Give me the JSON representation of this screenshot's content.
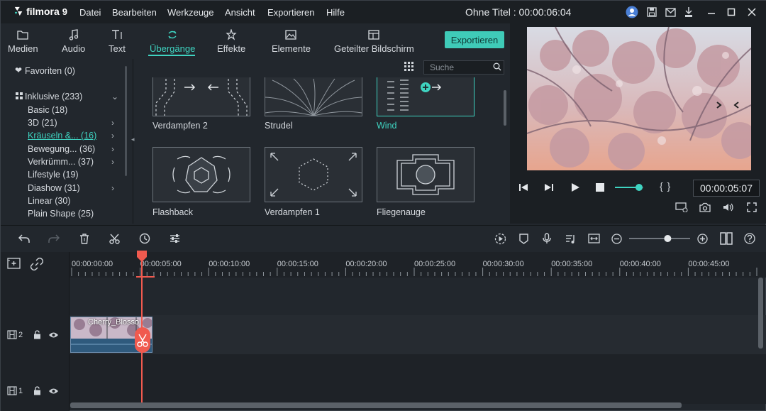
{
  "app": {
    "brand": "filmora",
    "version": "9"
  },
  "menu": {
    "items": [
      "Datei",
      "Bearbeiten",
      "Werkzeuge",
      "Ansicht",
      "Exportieren",
      "Hilfe"
    ]
  },
  "window": {
    "title": "Ohne Titel : 00:00:06:04"
  },
  "tabs": [
    {
      "label": "Medien",
      "icon": "folder-icon"
    },
    {
      "label": "Audio",
      "icon": "music-note-icon"
    },
    {
      "label": "Text",
      "icon": "text-icon"
    },
    {
      "label": "Übergänge",
      "icon": "transition-icon",
      "active": true
    },
    {
      "label": "Effekte",
      "icon": "effects-icon"
    },
    {
      "label": "Elemente",
      "icon": "image-icon"
    },
    {
      "label": "Geteilter Bildschirm",
      "icon": "split-screen-icon"
    }
  ],
  "export_label": "Exportieren",
  "search": {
    "placeholder": "Suche"
  },
  "sidebar": {
    "favorites": "Favoriten (0)",
    "inclusive": "Inklusive (233)",
    "items": [
      {
        "label": "Basic (18)",
        "arrow": false
      },
      {
        "label": "3D (21)",
        "arrow": true
      },
      {
        "label": "Kräuseln &... (16)",
        "arrow": true,
        "active": true
      },
      {
        "label": "Bewegung... (36)",
        "arrow": true
      },
      {
        "label": "Verkrümm... (37)",
        "arrow": true
      },
      {
        "label": "Lifestyle (19)",
        "arrow": false
      },
      {
        "label": "Diashow (31)",
        "arrow": true
      },
      {
        "label": "Linear (30)",
        "arrow": false
      },
      {
        "label": "Plain Shape (25)",
        "arrow": false
      }
    ]
  },
  "transitions": [
    {
      "label": "Verdampfen 2"
    },
    {
      "label": "Strudel"
    },
    {
      "label": "Wind",
      "selected": true
    },
    {
      "label": "Flashback"
    },
    {
      "label": "Verdampfen 1"
    },
    {
      "label": "Fliegenauge"
    }
  ],
  "preview": {
    "timecode": "00:00:05:07",
    "progress": 0.85
  },
  "timeline": {
    "ticks": [
      "00:00:00:00",
      "00:00:05:00",
      "00:00:10:00",
      "00:00:15:00",
      "00:00:20:00",
      "00:00:25:00",
      "00:00:30:00",
      "00:00:35:00",
      "00:00:40:00",
      "00:00:45:00"
    ],
    "tracks": [
      {
        "label": "2"
      },
      {
        "label": "1"
      }
    ],
    "clip_title": "Cherry_Blosso",
    "zoom": 0.65
  },
  "colors": {
    "accent": "#3fd4c1",
    "playhead": "#f05a4f",
    "clip": "#3e6a8d"
  }
}
